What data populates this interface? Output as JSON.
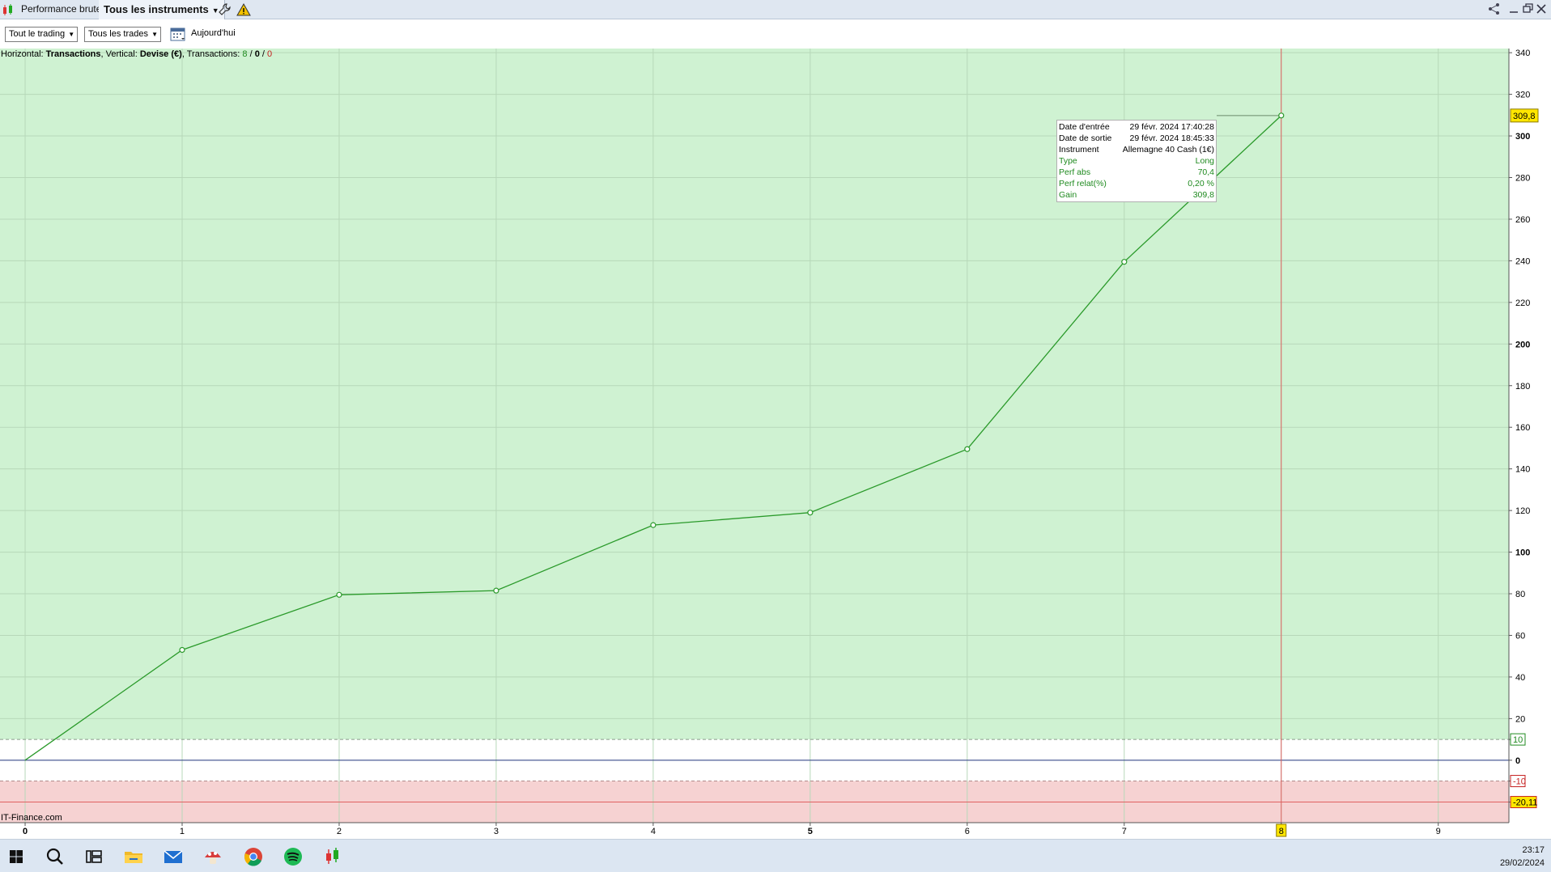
{
  "titlebar": {
    "tab_performance": "Performance brute",
    "tab_instruments": "Tous les instruments",
    "icons": [
      "app-logo-icon",
      "wrench-icon",
      "warning-icon",
      "share-icon",
      "minimize-icon",
      "restore-icon",
      "close-icon"
    ]
  },
  "toolbar": {
    "trading_filter": "Tout le trading",
    "trades_filter": "Tous les trades",
    "today_label": "Aujourd'hui"
  },
  "info": {
    "horizontal_label": "Horizontal:",
    "horizontal_value": "Transactions",
    "vertical_label": "Vertical:",
    "vertical_value": "Devise (€)",
    "transactions_label": "Transactions:",
    "count_green": "8",
    "count_zero": "0",
    "count_red": "0",
    "sep": " / "
  },
  "tooltip": {
    "rows": [
      {
        "label": "Date d'entrée",
        "value": "29 févr. 2024 17:40:28"
      },
      {
        "label": "Date de sortie",
        "value": "29 févr. 2024 18:45:33"
      },
      {
        "label": "Instrument",
        "value": "Allemagne 40 Cash (1€)"
      },
      {
        "label": "Type",
        "value": "Long"
      },
      {
        "label": "Perf abs",
        "value": "70,4"
      },
      {
        "label": "Perf relat(%)",
        "value": "0,20 %"
      },
      {
        "label": "Gain",
        "value": "309,8"
      }
    ]
  },
  "watermark": "IT-Finance.com",
  "chart_data": {
    "type": "line",
    "x": [
      0,
      1,
      2,
      3,
      4,
      5,
      6,
      7,
      8
    ],
    "values": [
      0,
      53,
      79.5,
      81.5,
      113,
      119,
      149.5,
      239.5,
      309.8
    ],
    "x_ticks": [
      "0",
      "1",
      "2",
      "3",
      "4",
      "5",
      "6",
      "7",
      "8",
      "9"
    ],
    "y_ticks": [
      "-20,11",
      "-10",
      "0",
      "10",
      "20",
      "40",
      "60",
      "80",
      "100",
      "120",
      "140",
      "160",
      "180",
      "200",
      "220",
      "240",
      "260",
      "280",
      "300",
      "320",
      "340"
    ],
    "xlim": [
      -0.16,
      9.45
    ],
    "ylim": [
      -30,
      342
    ],
    "cursor_x": 8,
    "cursor_x_label": "8",
    "cursor_y_label": "309,8",
    "profit_threshold": 10,
    "loss_threshold": -10,
    "min_value_label": -20.11,
    "colors": {
      "line": "#2a9a2a",
      "profit_zone": "#cff2d2",
      "loss_zone": "#f6d2d2",
      "cursor": "#e06060",
      "highlight": "#ffe600"
    }
  },
  "taskbar": {
    "icons": [
      "windows-start-icon",
      "search-icon",
      "task-view-icon",
      "file-explorer-icon",
      "mail-icon",
      "mushroom-app-icon",
      "chrome-icon",
      "spotify-icon",
      "trading-app-icon"
    ],
    "time": "23:17",
    "date": "29/02/2024"
  }
}
